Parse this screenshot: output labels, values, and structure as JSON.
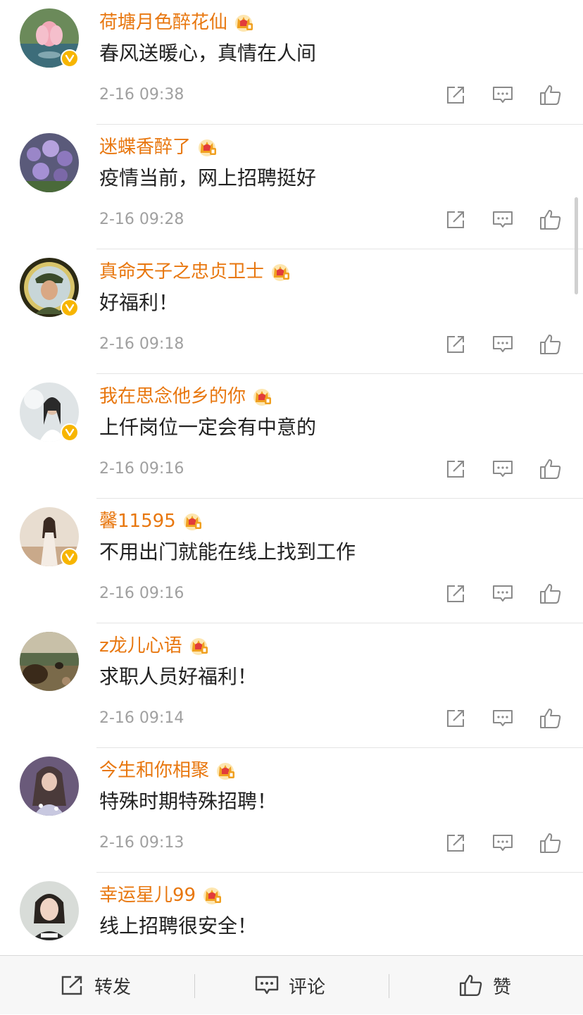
{
  "comments": [
    {
      "name": "荷塘月色醉花仙",
      "text": "春风送暖心，真情在人间",
      "time": "2-16 09:38",
      "verified": true
    },
    {
      "name": "迷蝶香醉了",
      "text": "疫情当前，网上招聘挺好",
      "time": "2-16 09:28",
      "verified": false
    },
    {
      "name": "真命天子之忠贞卫士",
      "text": "好福利！",
      "time": "2-16 09:18",
      "verified": true
    },
    {
      "name": "我在思念他乡的你",
      "text": "上仟岗位一定会有中意的",
      "time": "2-16 09:16",
      "verified": true
    },
    {
      "name": "馨11595",
      "text": "不用出门就能在线上找到工作",
      "time": "2-16 09:16",
      "verified": true
    },
    {
      "name": "z龙儿心语",
      "text": "求职人员好福利！",
      "time": "2-16 09:14",
      "verified": false
    },
    {
      "name": "今生和你相聚",
      "text": "特殊时期特殊招聘！",
      "time": "2-16 09:13",
      "verified": false
    },
    {
      "name": "幸运星儿99",
      "text": "线上招聘很安全！",
      "time": "",
      "verified": false
    }
  ],
  "bottom_bar": {
    "repost_label": "转发",
    "comment_label": "评论",
    "like_label": "赞"
  },
  "colors": {
    "username": "#e8770f",
    "timestamp": "#a0a0a0",
    "verified_badge": "#f7b500",
    "crown": "#f0a020",
    "icon": "#8a8a8a"
  },
  "icons": [
    "verified-badge-icon",
    "vip-crown-icon",
    "share-icon",
    "reply-icon",
    "like-icon"
  ]
}
